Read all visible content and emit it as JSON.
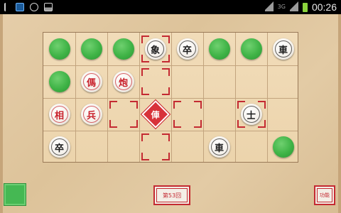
{
  "status_bar": {
    "time": "00:26",
    "network": "3G",
    "left_icons": [
      "usb-icon",
      "wave-icon",
      "clock-icon",
      "picture-icon"
    ]
  },
  "colors": {
    "red_piece": "#c8202a",
    "black_piece": "#1b1b1b",
    "hidden_piece": "#3fb346",
    "marker": "#c42a32",
    "board": "#ecd4ac"
  },
  "board": {
    "cols": 8,
    "rows": 4,
    "pieces": [
      {
        "col": 0,
        "row": 0,
        "type": "hidden"
      },
      {
        "col": 1,
        "row": 0,
        "type": "hidden"
      },
      {
        "col": 2,
        "row": 0,
        "type": "hidden"
      },
      {
        "col": 3,
        "row": 0,
        "type": "black",
        "char": "象"
      },
      {
        "col": 4,
        "row": 0,
        "type": "black",
        "char": "卒"
      },
      {
        "col": 5,
        "row": 0,
        "type": "hidden"
      },
      {
        "col": 6,
        "row": 0,
        "type": "hidden"
      },
      {
        "col": 7,
        "row": 0,
        "type": "black",
        "char": "車"
      },
      {
        "col": 0,
        "row": 1,
        "type": "hidden"
      },
      {
        "col": 1,
        "row": 1,
        "type": "red",
        "char": "傌"
      },
      {
        "col": 2,
        "row": 1,
        "type": "red",
        "char": "炮"
      },
      {
        "col": 0,
        "row": 2,
        "type": "red",
        "char": "相"
      },
      {
        "col": 1,
        "row": 2,
        "type": "red",
        "char": "兵"
      },
      {
        "col": 3,
        "row": 2,
        "type": "red",
        "char": "俥",
        "selected": true
      },
      {
        "col": 6,
        "row": 2,
        "type": "black",
        "char": "士"
      },
      {
        "col": 0,
        "row": 3,
        "type": "black",
        "char": "卒"
      },
      {
        "col": 5,
        "row": 3,
        "type": "black",
        "char": "車"
      },
      {
        "col": 7,
        "row": 3,
        "type": "hidden"
      }
    ],
    "move_markers": [
      {
        "col": 3,
        "row": 0
      },
      {
        "col": 3,
        "row": 1
      },
      {
        "col": 2,
        "row": 2
      },
      {
        "col": 4,
        "row": 2
      },
      {
        "col": 6,
        "row": 2
      },
      {
        "col": 3,
        "row": 3
      }
    ]
  },
  "controls": {
    "round_label": "第53回",
    "hint_label": "功能"
  }
}
